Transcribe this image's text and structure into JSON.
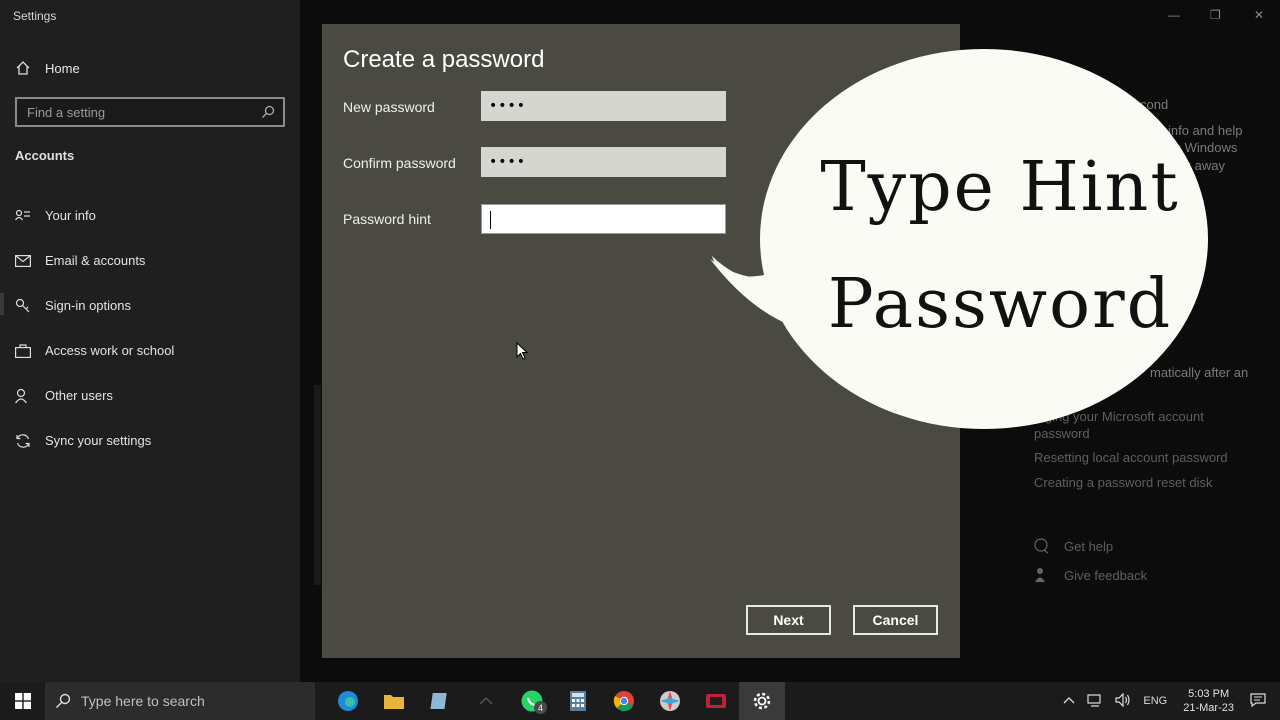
{
  "window": {
    "title": "Settings",
    "controls": {
      "minimize": "—",
      "maximize": "❐",
      "close": "✕"
    }
  },
  "sidebar": {
    "home_label": "Home",
    "search_placeholder": "Find a setting",
    "section_title": "Accounts",
    "items": [
      {
        "label": "Your info",
        "icon": "person-card-icon"
      },
      {
        "label": "Email & accounts",
        "icon": "mail-icon"
      },
      {
        "label": "Sign-in options",
        "icon": "key-icon"
      },
      {
        "label": "Access work or school",
        "icon": "briefcase-icon"
      },
      {
        "label": "Other users",
        "icon": "people-icon"
      },
      {
        "label": "Sync your settings",
        "icon": "sync-icon"
      }
    ]
  },
  "right_panel": {
    "partial_heading": "cond",
    "partial_lines": [
      "info and help",
      "ss Windows",
      "ck away"
    ],
    "partial_line_lock": "matically after an",
    "links": [
      "...ging your Microsoft account password",
      "Resetting local account password",
      "Creating a password reset disk"
    ],
    "help": "Get help",
    "feedback": "Give feedback"
  },
  "dialog": {
    "title": "Create a password",
    "fields": [
      {
        "label": "New password",
        "value": "••••"
      },
      {
        "label": "Confirm password",
        "value": "••••"
      },
      {
        "label": "Password hint",
        "value": ""
      }
    ],
    "next_label": "Next",
    "cancel_label": "Cancel"
  },
  "overlay": {
    "line1": "Type Hint",
    "line2": "Password"
  },
  "taskbar": {
    "search_placeholder": "Type here to search",
    "whatsapp_badge": "4",
    "language": "ENG",
    "time": "5:03 PM",
    "date": "21-Mar-23",
    "colors": {
      "edge": "#1f8bd6",
      "folder": "#e8b43a",
      "whatsapp": "#25d366",
      "calculator": "#4a7a3a",
      "chrome": "#db4437"
    }
  }
}
